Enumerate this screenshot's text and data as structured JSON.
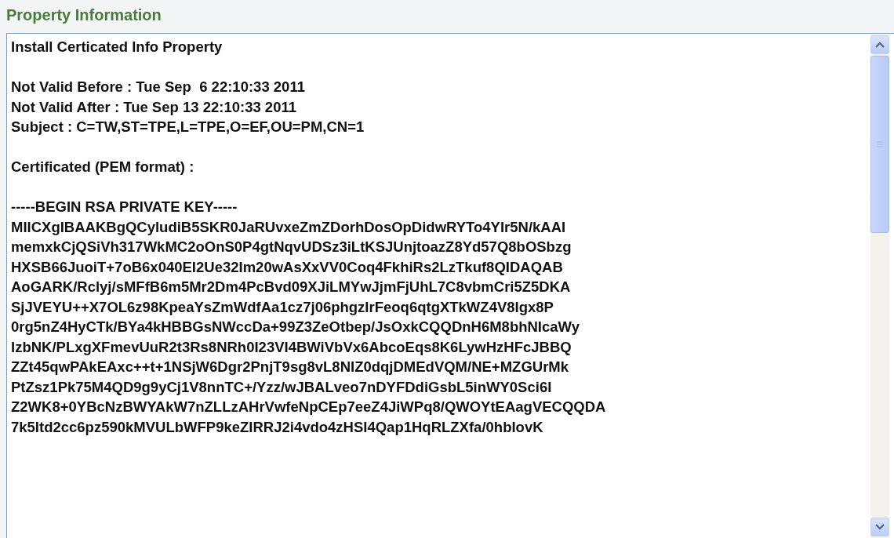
{
  "section_title": "Property Information",
  "text_area": {
    "paragraphs": [
      [
        "Install Certicated Info Property"
      ],
      [
        "Not Valid Before : Tue Sep  6 22:10:33 2011",
        "Not Valid After : Tue Sep 13 22:10:33 2011",
        "Subject : C=TW,ST=TPE,L=TPE,O=EF,OU=PM,CN=1"
      ],
      [
        "Certificated (PEM format) :"
      ],
      [
        "-----BEGIN RSA PRIVATE KEY-----",
        "MIICXgIBAAKBgQCyludiB5SKR0JaRUvxeZmZDorhDosOpDidwRYTo4YIr5N/kAAI",
        "memxkCjQSiVh317WkMC2oOnS0P4gtNqvUDSz3iLtKSJUnjtoazZ8Yd57Q8bOSbzg",
        "HXSB66JuoiT+7oB6x040EI2Ue32Im20wAsXxVV0Coq4FkhiRs2LzTkuf8QIDAQAB",
        "AoGARK/Rclyj/sMFfB6m5Mr2Dm4PcBvd09XJiLMYwJjmFjUhL7C8vbmCri5Z5DKA",
        "SjJVEYU++X7OL6z98KpeaYsZmWdfAa1cz7j06phgzIrFeoq6qtgXTkWZ4V8Igx8P",
        "0rg5nZ4HyCTk/BYa4kHBBGsNWccDa+99Z3ZeOtbep/JsOxkCQQDnH6M8bhNIcaWy",
        "IzbNK/PLxgXFmevUuR2t3Rs8NRh0I23VI4BWiVbVx6AbcoEqs8K6LywHzHFcJBBQ",
        "ZZt45qwPAkEAxc++t+1NSjW6Dgr2PnjT9sg8vL8NIZ0dqjDMEdVQM/NE+MZGUrMk",
        "PtZsz1Pk75M4QD9g9yCj1V8nnTC+/Yzz/wJBALveo7nDYFDdiGsbL5inWY0Sci6I",
        "Z2WK8+0YBcNzBWYAkW7nZLLzAHrVwfeNpCEp7eeZ4JiWPq8/QWOYtEAagVECQQDA",
        "7k5Itd2cc6pz590kMVULbWFP9keZIRRJ2i4vdo4zHSI4Qap1HqRLZXfa/0hbIovK"
      ]
    ]
  }
}
